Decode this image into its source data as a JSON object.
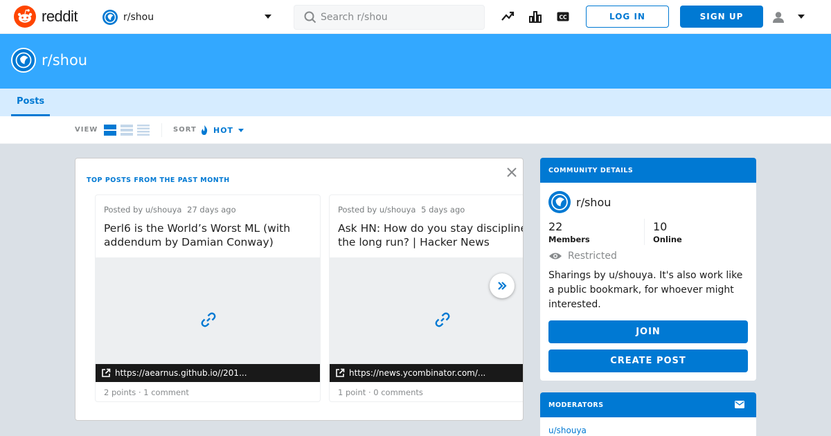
{
  "header": {
    "logo_text": "reddit",
    "community_selector": "r/shou",
    "search_placeholder": "Search r/shou",
    "login_label": "LOG IN",
    "signup_label": "SIGN UP",
    "icons": [
      "trending-icon",
      "stats-icon",
      "closed-caption-icon",
      "user-icon"
    ]
  },
  "banner": {
    "title": "r/shou"
  },
  "tabs": [
    {
      "label": "Posts",
      "active": true
    }
  ],
  "sortbar": {
    "view_label": "VIEW",
    "sort_label": "SORT",
    "sort_value": "HOT"
  },
  "top_posts": {
    "heading": "TOP POSTS FROM THE PAST MONTH",
    "posts": [
      {
        "posted_by": "Posted by u/shouya",
        "age": "27 days ago",
        "title": "Perl6 is the World’s Worst ML (with addendum by Damian Conway)",
        "url": "https://aearnus.github.io//201...",
        "stats": "2 points · 1 comment"
      },
      {
        "posted_by": "Posted by u/shouya",
        "age": "5 days ago",
        "title": "Ask HN: How do you stay disciplined the long run? | Hacker News",
        "url": "https://news.ycombinator.com/...",
        "stats": "1 point · 0 comments"
      }
    ]
  },
  "community": {
    "heading": "COMMUNITY DETAILS",
    "name": "r/shou",
    "members_count": "22",
    "members_label": "Members",
    "online_count": "10",
    "online_label": "Online",
    "restricted_label": "Restricted",
    "description": "Sharings by u/shouya. It's also work like a public bookmark, for whoever might interested.",
    "join_label": "JOIN",
    "create_post_label": "CREATE POST"
  },
  "moderators": {
    "heading": "MODERATORS",
    "first": "u/shouya"
  },
  "colors": {
    "accent": "#0079d3",
    "banner": "#33a8ff",
    "tabs_bg": "#d6ecff",
    "logo": "#ff4500",
    "page_bg": "#dae0e6"
  }
}
